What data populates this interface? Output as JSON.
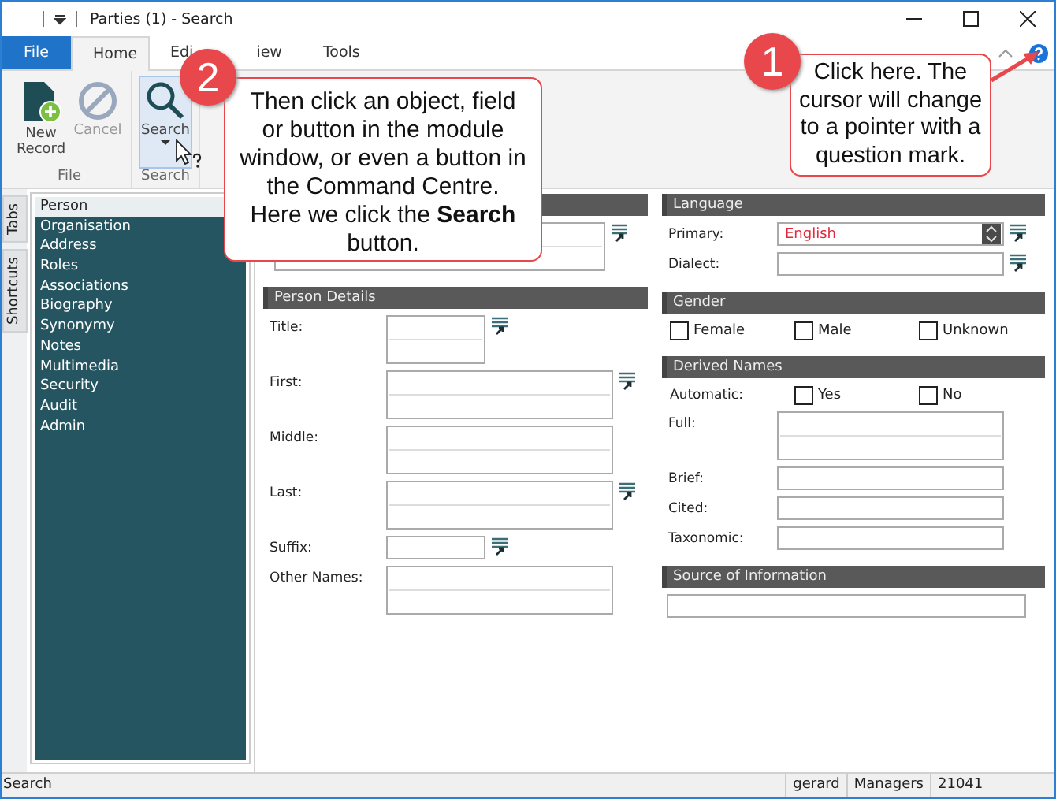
{
  "window": {
    "title": "Parties (1) - Search"
  },
  "tabs": [
    {
      "label": "File",
      "kind": "file",
      "selected": false
    },
    {
      "label": "Home",
      "kind": "tab",
      "selected": true
    },
    {
      "label": "Edi",
      "kind": "tab",
      "selected": false
    },
    {
      "label": "iew",
      "kind": "tab",
      "selected": false
    },
    {
      "label": "Tools",
      "kind": "tab",
      "selected": false
    }
  ],
  "ribbon": [
    {
      "label": "File",
      "buttons": [
        {
          "label": "New Record",
          "kind": "new",
          "disabled": false,
          "highlighted": false
        },
        {
          "label": "Cancel",
          "kind": "cancel",
          "disabled": true,
          "highlighted": false
        }
      ]
    },
    {
      "label": "Search",
      "buttons": [
        {
          "label": "Search",
          "kind": "search",
          "disabled": false,
          "highlighted": true
        }
      ]
    }
  ],
  "side_tabs": [
    "Tabs",
    "Shortcuts"
  ],
  "sidebar": {
    "items": [
      {
        "label": "Person",
        "selected": true
      },
      {
        "label": "Organisation",
        "selected": false
      },
      {
        "label": "Address",
        "selected": false
      },
      {
        "label": "Roles",
        "selected": false
      },
      {
        "label": "Associations",
        "selected": false
      },
      {
        "label": "Biography",
        "selected": false
      },
      {
        "label": "Synonymy",
        "selected": false
      },
      {
        "label": "Notes",
        "selected": false
      },
      {
        "label": "Multimedia",
        "selected": false
      },
      {
        "label": "Security",
        "selected": false
      },
      {
        "label": "Audit",
        "selected": false
      },
      {
        "label": "Admin",
        "selected": false
      }
    ]
  },
  "form": {
    "left": [
      {
        "fields": [
          {
            "kind": "wide-multi",
            "lookup": true
          }
        ]
      },
      {
        "title": "Person Details",
        "fields": [
          {
            "label": "Title:",
            "kind": "short-multi",
            "lookup": true
          },
          {
            "label": "First:",
            "kind": "long-multi",
            "lookup": true
          },
          {
            "label": "Middle:",
            "kind": "long-multi",
            "lookup": false
          },
          {
            "label": "Last:",
            "kind": "long-multi",
            "lookup": true
          },
          {
            "label": "Suffix:",
            "kind": "short",
            "lookup": true
          },
          {
            "label": "Other Names:",
            "kind": "long-multi",
            "lookup": false
          }
        ]
      }
    ],
    "right": [
      {
        "title": "Language",
        "fields": [
          {
            "label": "Primary:",
            "kind": "spinner",
            "value": "English",
            "lookup": true
          },
          {
            "label": "Dialect:",
            "kind": "long",
            "lookup": true
          }
        ]
      },
      {
        "title": "Gender",
        "checkboxes": [
          {
            "label": "Female",
            "checked": false
          },
          {
            "label": "Male",
            "checked": false
          },
          {
            "label": "Unknown",
            "checked": false
          }
        ]
      },
      {
        "title": "Derived Names",
        "label": "Automatic:",
        "checkboxes": [
          {
            "label": "Yes",
            "checked": false
          },
          {
            "label": "No",
            "checked": false
          }
        ],
        "fields": [
          {
            "label": "Full:",
            "kind": "long-multi",
            "lookup": false
          },
          {
            "label": "Brief:",
            "kind": "long",
            "lookup": false
          },
          {
            "label": "Cited:",
            "kind": "long",
            "lookup": false
          },
          {
            "label": "Taxonomic:",
            "kind": "long",
            "lookup": false
          }
        ]
      },
      {
        "title": "Source of Information",
        "fields": [
          {
            "kind": "full",
            "lookup": false
          }
        ]
      }
    ]
  },
  "status_bar": {
    "message": "Search",
    "user": "gerard",
    "group": "Managers",
    "number": "21041"
  },
  "callouts": [
    {
      "number": "2",
      "text": "Then click an object, field or button in the module window, or even a button in the Command Centre. Here we click the **Search** button."
    },
    {
      "number": "1",
      "text": "Click here. The cursor will change to a pointer with a question mark."
    }
  ]
}
